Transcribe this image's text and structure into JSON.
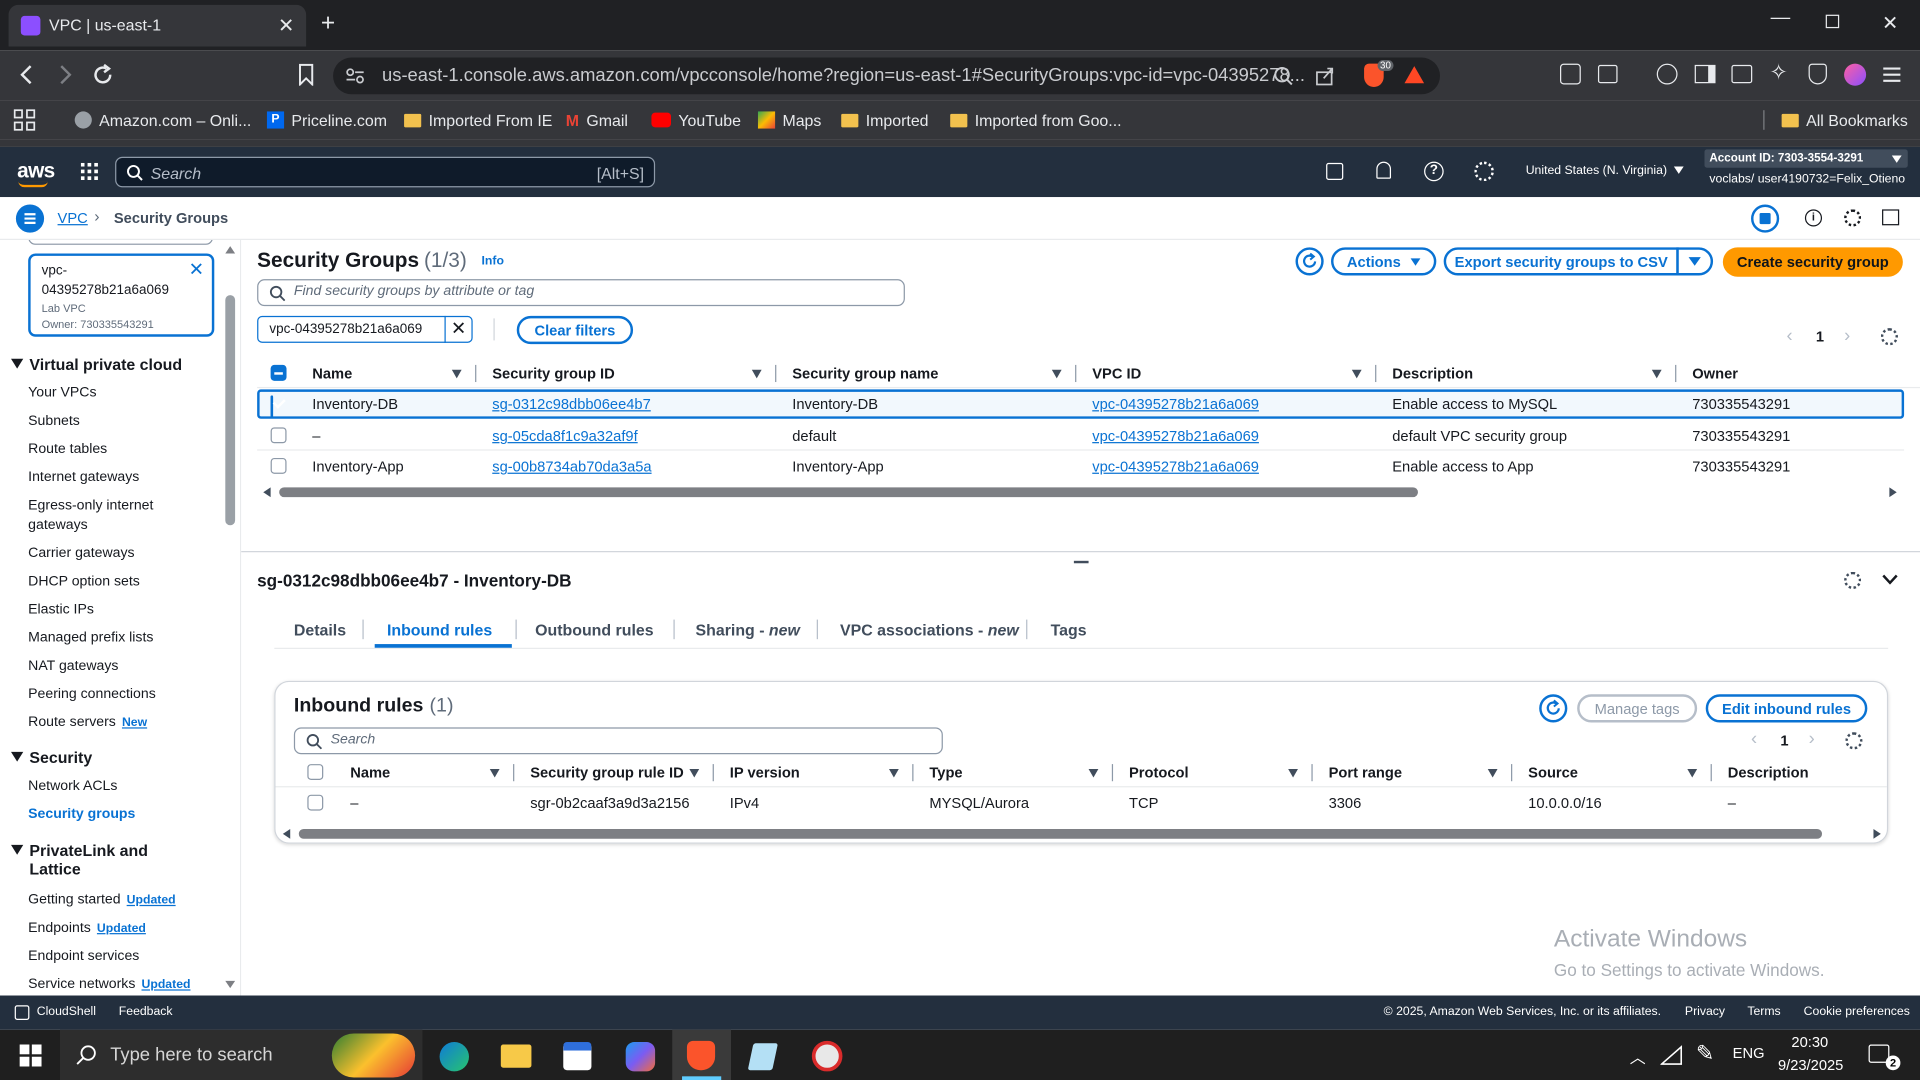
{
  "browser": {
    "tab_title": "VPC | us-east-1",
    "url": "us-east-1.console.aws.amazon.com/vpcconsole/home?region=us-east-1#SecurityGroups:vpc-id=vpc-04395278...",
    "brave_badge": "30",
    "bookmarks": [
      "Amazon.com – Onli...",
      "Priceline.com",
      "Imported From IE",
      "Gmail",
      "YouTube",
      "Maps",
      "Imported",
      "Imported from Goo...",
      "All Bookmarks"
    ]
  },
  "aws": {
    "logo": "aws",
    "search_placeholder": "Search",
    "search_shortcut": "[Alt+S]",
    "region": "United States (N. Virginia)",
    "account_id": "Account ID: 7303-3554-3291",
    "user": "voclabs/ user4190732=Felix_Otieno"
  },
  "breadcrumb": {
    "root": "VPC",
    "current": "Security Groups"
  },
  "sidebar": {
    "filter_card": {
      "vpc_id_line1": "vpc-",
      "vpc_id_line2": "04395278b21a6a069",
      "vpc_name": "Lab VPC",
      "owner": "Owner: 730335543291"
    },
    "sections": [
      {
        "title": "Virtual private cloud",
        "items": [
          "Your VPCs",
          "Subnets",
          "Route tables",
          "Internet gateways",
          "Egress-only internet gateways",
          "Carrier gateways",
          "DHCP option sets",
          "Elastic IPs",
          "Managed prefix lists",
          "NAT gateways",
          "Peering connections",
          "Route servers"
        ]
      },
      {
        "title": "Security",
        "items": [
          "Network ACLs",
          "Security groups"
        ]
      },
      {
        "title": "PrivateLink and Lattice",
        "items": [
          "Getting started",
          "Endpoints",
          "Endpoint services",
          "Service networks"
        ]
      }
    ],
    "badge_new": "New",
    "badge_updated": "Updated"
  },
  "sg_panel": {
    "title": "Security Groups",
    "count": "(1/3)",
    "info": "Info",
    "actions": "Actions",
    "export": "Export security groups to CSV",
    "create": "Create security group",
    "search_placeholder": "Find security groups by attribute or tag",
    "filter_token": "vpc-04395278b21a6a069",
    "clear_filters": "Clear filters",
    "page": "1",
    "columns": [
      "Name",
      "Security group ID",
      "Security group name",
      "VPC ID",
      "Description",
      "Owner"
    ],
    "rows": [
      {
        "name": "Inventory-DB",
        "sg_id": "sg-0312c98dbb06ee4b7",
        "sg_name": "Inventory-DB",
        "vpc_id": "vpc-04395278b21a6a069",
        "description": "Enable access to MySQL",
        "owner": "730335543291",
        "checked": true
      },
      {
        "name": "–",
        "sg_id": "sg-05cda8f1c9a32af9f",
        "sg_name": "default",
        "vpc_id": "vpc-04395278b21a6a069",
        "description": "default VPC security group",
        "owner": "730335543291",
        "checked": false
      },
      {
        "name": "Inventory-App",
        "sg_id": "sg-00b8734ab70da3a5a",
        "sg_name": "Inventory-App",
        "vpc_id": "vpc-04395278b21a6a069",
        "description": "Enable access to App",
        "owner": "730335543291",
        "checked": false
      }
    ]
  },
  "detail": {
    "title": "sg-0312c98dbb06ee4b7 - Inventory-DB",
    "tabs": [
      {
        "label": "Details",
        "suffix": ""
      },
      {
        "label": "Inbound rules",
        "suffix": ""
      },
      {
        "label": "Outbound rules",
        "suffix": ""
      },
      {
        "label": "Sharing - ",
        "suffix": "new"
      },
      {
        "label": "VPC associations - ",
        "suffix": "new"
      },
      {
        "label": "Tags",
        "suffix": ""
      }
    ],
    "active_tab": "Inbound rules",
    "rules_title": "Inbound rules",
    "rules_count": "(1)",
    "manage_tags": "Manage tags",
    "edit_rules": "Edit inbound rules",
    "search_placeholder": "Search",
    "page": "1",
    "columns": [
      "Name",
      "Security group rule ID",
      "IP version",
      "Type",
      "Protocol",
      "Port range",
      "Source",
      "Description"
    ],
    "rows": [
      {
        "name": "–",
        "rule_id": "sgr-0b2caaf3a9d3a2156",
        "ip_version": "IPv4",
        "type": "MYSQL/Aurora",
        "protocol": "TCP",
        "port_range": "3306",
        "source": "10.0.0.0/16",
        "description": "–"
      }
    ]
  },
  "watermark": {
    "line1": "Activate Windows",
    "line2": "Go to Settings to activate Windows."
  },
  "footer": {
    "cloudshell": "CloudShell",
    "feedback": "Feedback",
    "copyright": "© 2025, Amazon Web Services, Inc. or its affiliates.",
    "privacy": "Privacy",
    "terms": "Terms",
    "cookies": "Cookie preferences"
  },
  "taskbar": {
    "search_placeholder": "Type here to search",
    "lang": "ENG",
    "time": "20:30",
    "date": "9/23/2025",
    "notif_count": "2"
  }
}
